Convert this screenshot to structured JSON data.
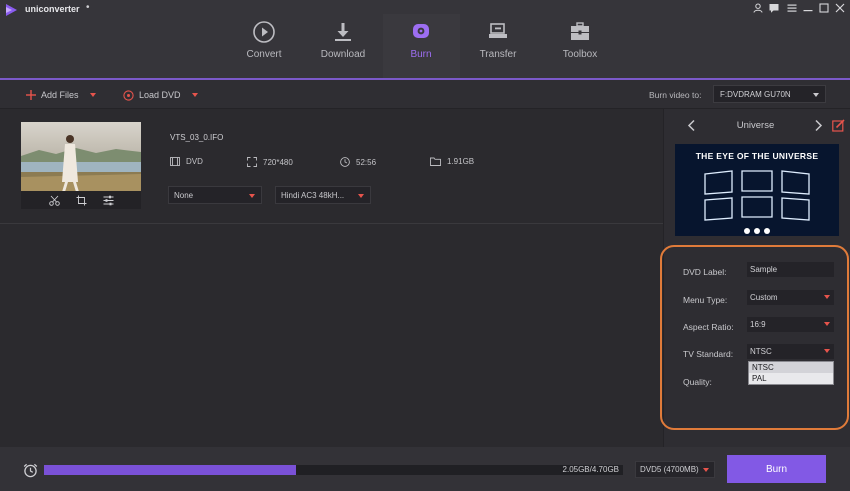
{
  "app": {
    "name": "uniconverter",
    "dot": "•"
  },
  "nav": [
    {
      "label": "Convert",
      "icon": "convert-icon"
    },
    {
      "label": "Download",
      "icon": "download-icon"
    },
    {
      "label": "Burn",
      "icon": "burn-icon",
      "active": true
    },
    {
      "label": "Transfer",
      "icon": "transfer-icon"
    },
    {
      "label": "Toolbox",
      "icon": "toolbox-icon"
    }
  ],
  "toolbar": {
    "add_files": "Add Files",
    "load_dvd": "Load DVD",
    "burn_to_label": "Burn video to:",
    "burn_to_value": "F:DVDRAM GU70N"
  },
  "file": {
    "name": "VTS_03_0.IFO",
    "format": "DVD",
    "resolution": "720*480",
    "duration": "52:56",
    "size": "1.91GB",
    "subtitle_select": "None",
    "audio_select": "Hindi AC3 48kH..."
  },
  "template": {
    "name": "Universe",
    "preview_title": "THE EYE OF THE UNIVERSE"
  },
  "settings": {
    "dvd_label": {
      "label": "DVD Label:",
      "value": "Sample"
    },
    "menu_type": {
      "label": "Menu Type:",
      "value": "Custom"
    },
    "aspect_ratio": {
      "label": "Aspect Ratio:",
      "value": "16:9"
    },
    "tv_standard": {
      "label": "TV Standard:",
      "value": "NTSC",
      "options": [
        "NTSC",
        "PAL"
      ]
    },
    "quality": {
      "label": "Quality:"
    }
  },
  "bottom": {
    "progress_text": "2.05GB/4.70GB",
    "progress_fraction": 0.436,
    "disc_type": "DVD5 (4700MB)",
    "burn_button": "Burn"
  },
  "colors": {
    "accent": "#8259e5",
    "highlight_box": "#e07b3a",
    "caret": "#e7544c"
  }
}
